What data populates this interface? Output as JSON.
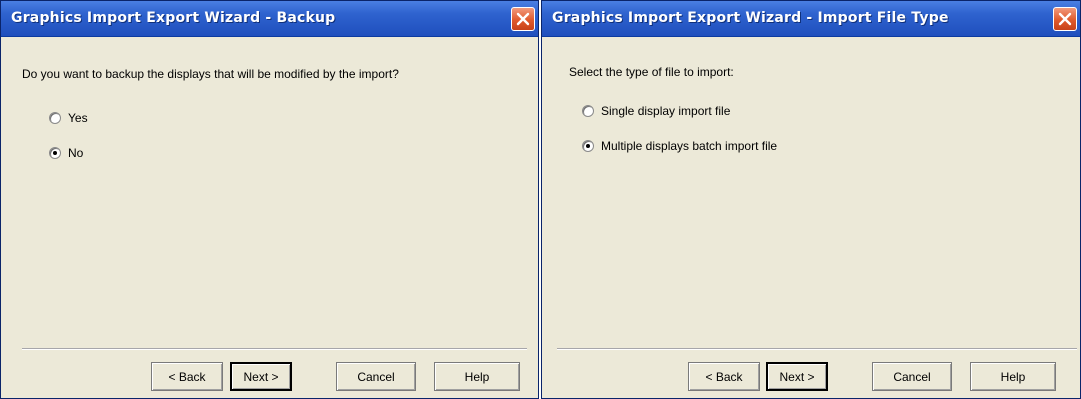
{
  "left_dialog": {
    "title": "Graphics Import Export Wizard - Backup",
    "question": "Do you want to backup the displays that will be modified by the import?",
    "options": [
      {
        "label": "Yes",
        "selected": false
      },
      {
        "label": "No",
        "selected": true
      }
    ],
    "buttons": {
      "back": "< Back",
      "next": "Next >",
      "cancel": "Cancel",
      "help": "Help"
    }
  },
  "right_dialog": {
    "title": "Graphics Import Export Wizard - Import File Type",
    "question": "Select the type of file to import:",
    "options": [
      {
        "label": "Single display import file",
        "selected": false
      },
      {
        "label": "Multiple displays batch import file",
        "selected": true
      }
    ],
    "buttons": {
      "back": "< Back",
      "next": "Next >",
      "cancel": "Cancel",
      "help": "Help"
    }
  },
  "icons": {
    "close": "close-icon"
  },
  "colors": {
    "titlebar": "#2f63cf",
    "close_button": "#e05a2c",
    "dialog_bg": "#ece9d8"
  }
}
